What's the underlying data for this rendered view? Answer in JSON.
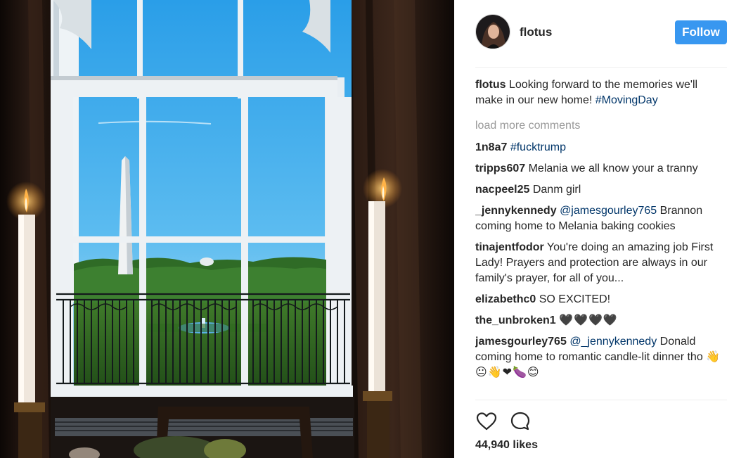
{
  "post": {
    "owner": "flotus",
    "follow_label": "Follow",
    "caption": {
      "user": "flotus",
      "text": "Looking forward to the memories we'll make in our new home!",
      "hashtag": "#MovingDay"
    },
    "load_more": "load more comments",
    "likes": "44,940 likes"
  },
  "comments": [
    {
      "user": "1n8a7",
      "tag": "#fucktrump"
    },
    {
      "user": "tripps607",
      "text": "Melania we all know your a tranny"
    },
    {
      "user": "nacpeel25",
      "text": "Danm girl"
    },
    {
      "user": "_jennykennedy",
      "mention": "@jamesgourley765",
      "text": "Brannon coming home to Melania baking cookies"
    },
    {
      "user": "tinajentfodor",
      "text": "You're doing an amazing job First Lady! Prayers and protection are always in our family's prayer, for all of you..."
    },
    {
      "user": "elizabethc0",
      "text": "SO EXCITED!"
    },
    {
      "user": "the_unbroken1",
      "emoji": "🖤🖤🖤🖤"
    },
    {
      "user": "jamesgourley765",
      "mention": "@_jennykennedy",
      "text": "Donald coming home to romantic candle-lit dinner tho",
      "emoji": "👋😐👋❤🍆😊"
    }
  ],
  "icons": {
    "like": "heart-outline-icon",
    "comment": "speech-bubble-icon"
  },
  "colors": {
    "follow_button": "#3897f0",
    "link": "#003569",
    "muted": "#999999"
  }
}
